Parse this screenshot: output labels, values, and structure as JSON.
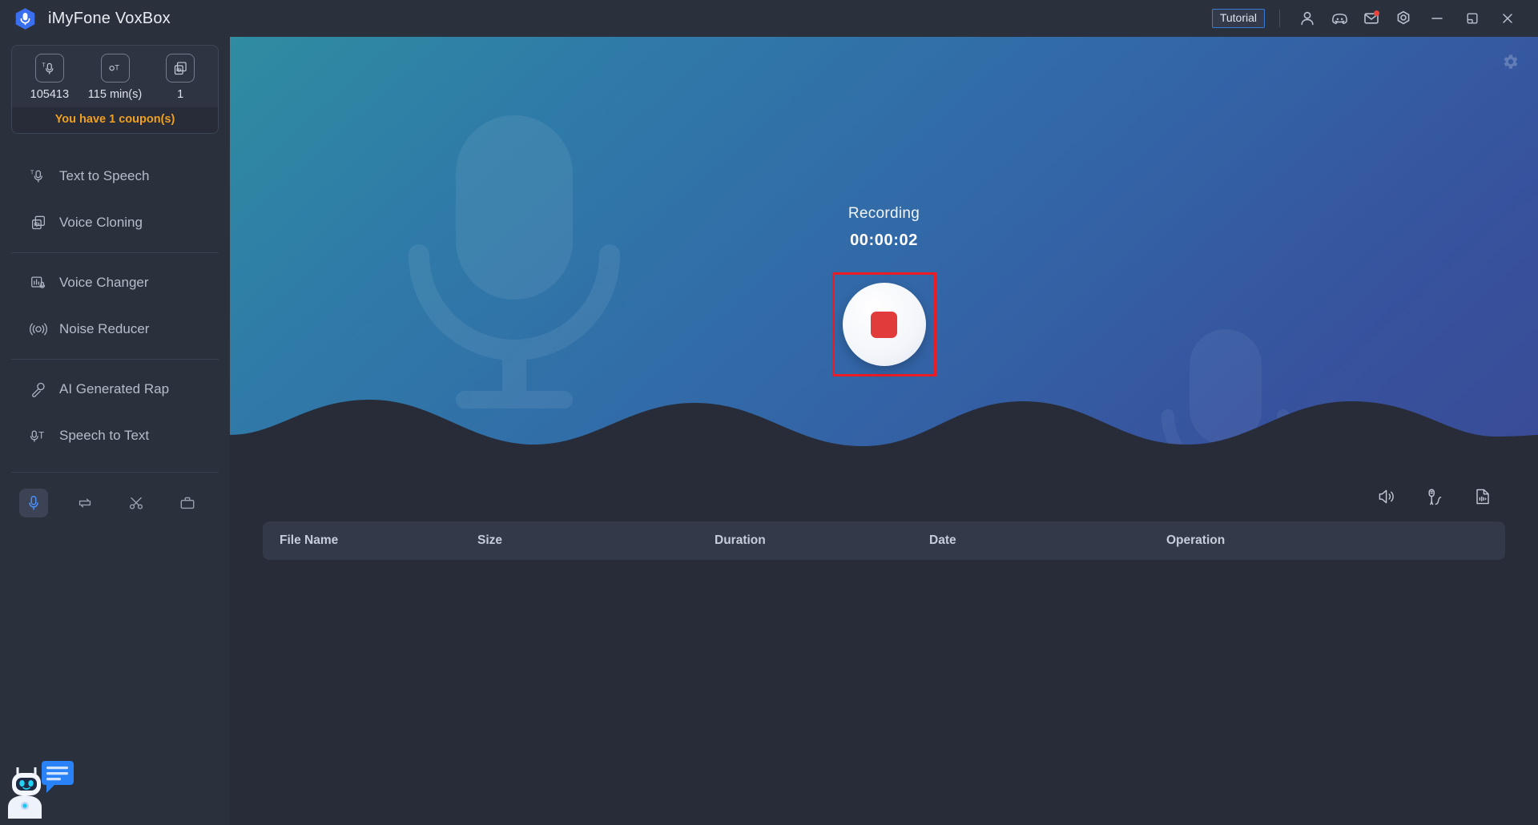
{
  "window": {
    "app_title": "iMyFone VoxBox",
    "logo_icon": "microphone-badge-icon"
  },
  "titlebar": {
    "tutorial_label": "Tutorial",
    "icons": [
      {
        "name": "account-icon",
        "glyph": "person"
      },
      {
        "name": "community-icon",
        "glyph": "discord"
      },
      {
        "name": "mail-icon",
        "glyph": "envelope",
        "badge": true
      },
      {
        "name": "settings-icon",
        "glyph": "gear-hex"
      }
    ],
    "controls": [
      {
        "name": "minimize-button",
        "glyph": "minimize"
      },
      {
        "name": "maximize-button",
        "glyph": "maximize"
      },
      {
        "name": "close-button",
        "glyph": "close"
      }
    ]
  },
  "sidebar": {
    "credits": {
      "items": [
        {
          "icon": "text-to-speech-credit-icon",
          "value": "105413"
        },
        {
          "icon": "speech-to-text-credit-icon",
          "value": "115 min(s)"
        },
        {
          "icon": "voice-clone-credit-icon",
          "value": "1"
        }
      ],
      "coupon_text": "You have 1 coupon(s)"
    },
    "nav": [
      {
        "id": "text-to-speech",
        "label": "Text to Speech",
        "icon": "text-to-speech-icon"
      },
      {
        "id": "voice-cloning",
        "label": "Voice Cloning",
        "icon": "voice-cloning-icon"
      },
      {
        "id": "voice-changer",
        "label": "Voice Changer",
        "icon": "voice-changer-icon"
      },
      {
        "id": "noise-reducer",
        "label": "Noise Reducer",
        "icon": "noise-reducer-icon"
      },
      {
        "id": "ai-generated-rap",
        "label": "AI Generated Rap",
        "icon": "ai-rap-icon"
      },
      {
        "id": "speech-to-text",
        "label": "Speech to Text",
        "icon": "speech-to-text-icon"
      }
    ],
    "tools": [
      {
        "id": "recorder",
        "icon": "microphone-icon",
        "active": true
      },
      {
        "id": "converter",
        "icon": "loop-convert-icon",
        "active": false
      },
      {
        "id": "cutter",
        "icon": "scissors-icon",
        "active": false
      },
      {
        "id": "toolbox",
        "icon": "toolbox-icon",
        "active": false
      }
    ],
    "mascot": {
      "name": "chatbot-mascot",
      "icon": "robot-chat-icon"
    }
  },
  "hero": {
    "settings_icon": "recording-settings-icon",
    "status_label": "Recording",
    "elapsed_time": "00:00:02",
    "stop_button_label": "Stop recording",
    "highlight_color": "#ec1c24"
  },
  "file_list": {
    "tools": [
      {
        "id": "system-sound",
        "icon": "speaker-icon"
      },
      {
        "id": "microphone-source",
        "icon": "microphone-wave-icon"
      },
      {
        "id": "import-file",
        "icon": "audio-file-icon"
      }
    ],
    "columns": [
      {
        "id": "file-name",
        "label": "File Name"
      },
      {
        "id": "size",
        "label": "Size"
      },
      {
        "id": "duration",
        "label": "Duration"
      },
      {
        "id": "date",
        "label": "Date"
      },
      {
        "id": "operation",
        "label": "Operation"
      }
    ],
    "rows": []
  },
  "colors": {
    "app_bg": "#2b303d",
    "panel_bg": "#272c38",
    "accent_blue": "#4c8ef7",
    "coupon_orange": "#f0a020",
    "record_red": "#e23b3b",
    "hero_start": "#2f8ca1",
    "hero_end": "#3a4b96"
  }
}
